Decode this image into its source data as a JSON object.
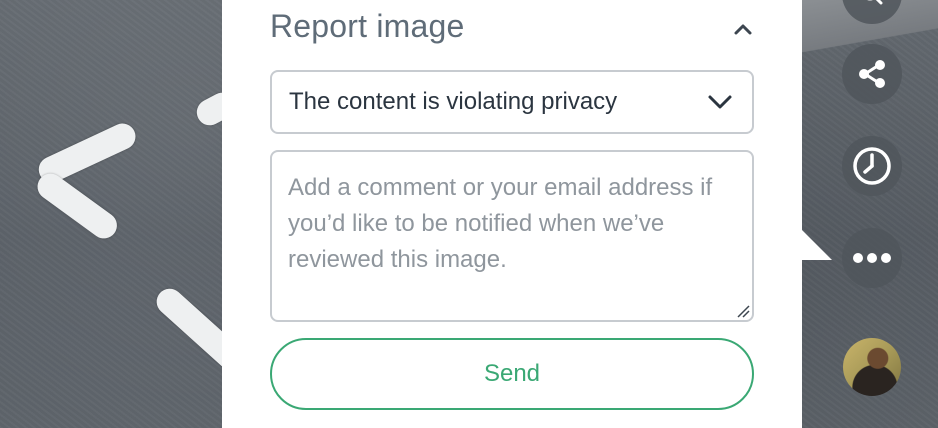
{
  "report": {
    "title": "Report image",
    "reason_selected": "The content is violating privacy",
    "comment_placeholder": "Add a comment or your email address if you’d like to be notified when we’ve reviewed this image.",
    "comment_value": "",
    "send_label": "Send"
  },
  "toolbar": {
    "items": [
      {
        "name": "share",
        "icon": "share-icon"
      },
      {
        "name": "history",
        "icon": "clock-icon"
      },
      {
        "name": "more",
        "icon": "more-icon"
      },
      {
        "name": "profile",
        "icon": "avatar"
      }
    ]
  },
  "colors": {
    "accent": "#3aa874",
    "title": "#5f6c78",
    "border": "#c7cbd0",
    "text": "#2b3540",
    "placeholder": "#8f969d"
  }
}
